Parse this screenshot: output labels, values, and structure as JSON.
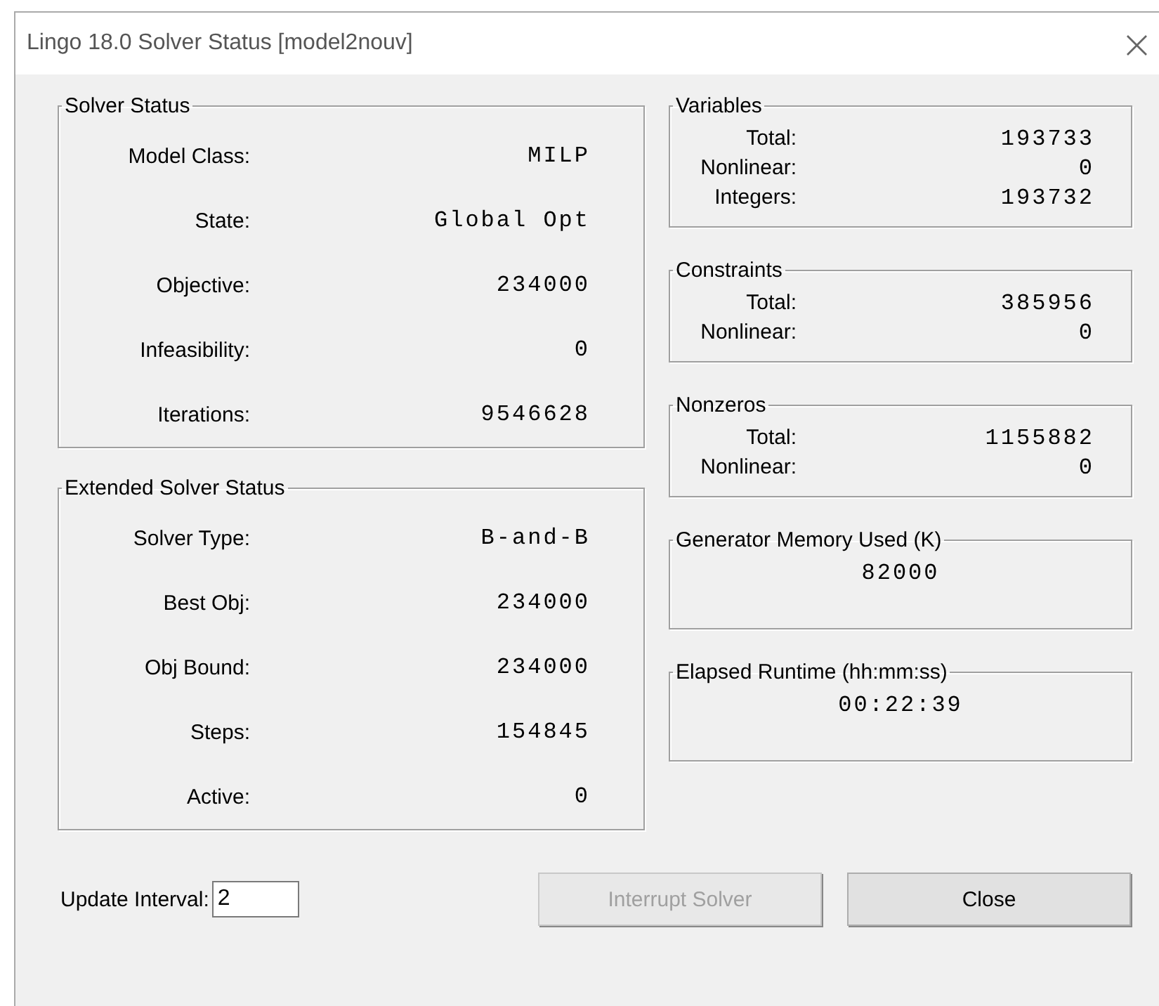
{
  "window": {
    "title": "Lingo 18.0 Solver Status [model2nouv]",
    "close": "×"
  },
  "left_groups": [
    {
      "title": "Solver Status",
      "kind": "rows",
      "rows": [
        {
          "label": "Model Class:",
          "value": "MILP"
        },
        {
          "label": "State:",
          "value": "Global Opt"
        },
        {
          "label": "Objective:",
          "value": "234000"
        },
        {
          "label": "Infeasibility:",
          "value": "0"
        },
        {
          "label": "Iterations:",
          "value": "9546628"
        }
      ]
    },
    {
      "title": "Extended Solver Status",
      "kind": "rows",
      "rows": [
        {
          "label": "Solver Type:",
          "value": "B-and-B"
        },
        {
          "label": "Best Obj:",
          "value": "234000"
        },
        {
          "label": "Obj Bound:",
          "value": "234000"
        },
        {
          "label": "Steps:",
          "value": "154845"
        },
        {
          "label": "Active:",
          "value": "0"
        }
      ]
    }
  ],
  "right_groups": [
    {
      "title": "Variables",
      "kind": "rows",
      "rows": [
        {
          "label": "Total:",
          "value": "193733"
        },
        {
          "label": "Nonlinear:",
          "value": "0"
        },
        {
          "label": "Integers:",
          "value": "193732"
        }
      ]
    },
    {
      "title": "Constraints",
      "kind": "rows",
      "rows": [
        {
          "label": "Total:",
          "value": "385956"
        },
        {
          "label": "Nonlinear:",
          "value": "0"
        }
      ]
    },
    {
      "title": "Nonzeros",
      "kind": "rows",
      "rows": [
        {
          "label": "Total:",
          "value": "1155882"
        },
        {
          "label": "Nonlinear:",
          "value": "0"
        }
      ]
    },
    {
      "title": "Generator Memory Used (K)",
      "kind": "single",
      "value": "82000"
    },
    {
      "title": "Elapsed Runtime (hh:mm:ss)",
      "kind": "single",
      "value": "00:22:39"
    }
  ],
  "update_interval": {
    "label": "Update Interval:",
    "value": "2"
  },
  "buttons": [
    {
      "label": "Interrupt Solver",
      "disabled": true
    },
    {
      "label": "Close",
      "disabled": false
    }
  ]
}
